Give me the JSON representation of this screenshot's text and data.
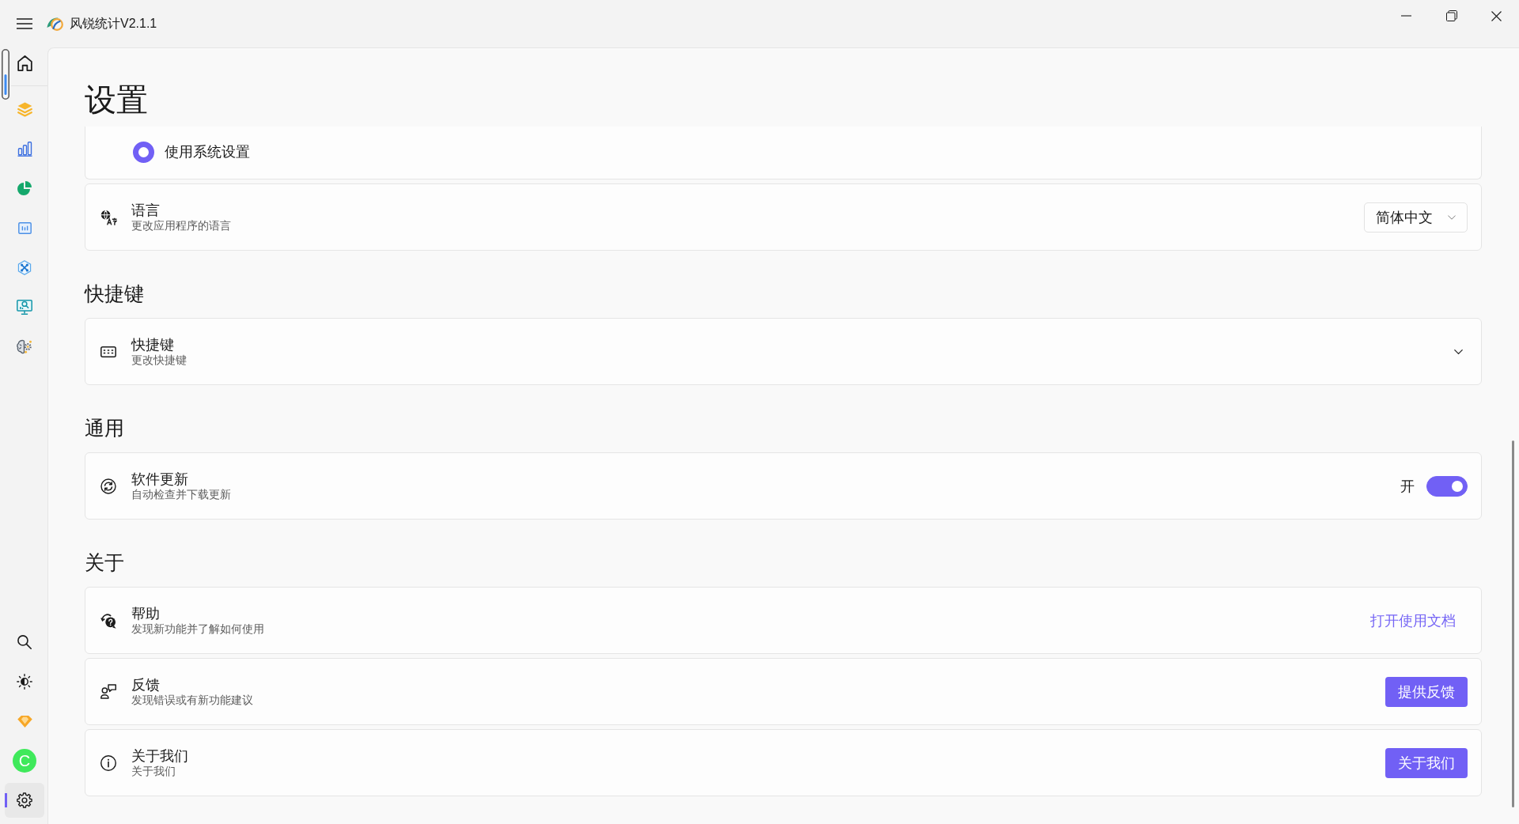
{
  "window": {
    "title": "风锐统计V2.1.1"
  },
  "sidebar": {
    "items": [
      {
        "selected": false
      },
      {
        "selected": false
      },
      {
        "selected": false
      },
      {
        "selected": false
      },
      {
        "selected": false
      },
      {
        "selected": false
      },
      {
        "selected": false
      },
      {
        "selected": false
      }
    ],
    "footer_items": [
      {
        "kind": "icon",
        "selected": false
      },
      {
        "kind": "icon",
        "selected": false
      },
      {
        "kind": "icon",
        "selected": false
      },
      {
        "kind": "avatar",
        "label": "C",
        "selected": false
      },
      {
        "kind": "icon",
        "selected": true
      }
    ]
  },
  "page": {
    "title": "设置"
  },
  "sections": [
    {
      "cards": [
        {
          "kind": "radio_options",
          "options": [
            {
              "label": "使用系统设置",
              "selected": true
            }
          ]
        },
        {
          "kind": "dropdown",
          "title": "语言",
          "description": "更改应用程序的语言",
          "value": "简体中文"
        }
      ]
    },
    {
      "heading": "快捷键",
      "cards": [
        {
          "kind": "expander",
          "title": "快捷键",
          "description": "更改快捷键",
          "expanded": false
        }
      ]
    },
    {
      "heading": "通用",
      "cards": [
        {
          "kind": "toggle",
          "title": "软件更新",
          "description": "自动检查并下载更新",
          "state_label": "开",
          "on": true
        }
      ]
    },
    {
      "heading": "关于",
      "cards": [
        {
          "kind": "link",
          "title": "帮助",
          "description": "发现新功能并了解如何使用",
          "action": "打开使用文档"
        },
        {
          "kind": "button",
          "title": "反馈",
          "description": "发现错误或有新功能建议",
          "action": "提供反馈"
        },
        {
          "kind": "button",
          "title": "关于我们",
          "description": "关于我们",
          "action": "关于我们"
        }
      ]
    }
  ]
}
